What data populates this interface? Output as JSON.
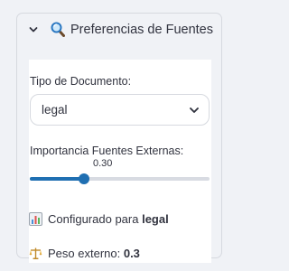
{
  "expander": {
    "title": "Preferencias de Fuentes",
    "toggle_icon": "chevron-down-icon",
    "title_icon": "magnifier-icon"
  },
  "document_type": {
    "label": "Tipo de Documento:",
    "selected": "legal",
    "dropdown_icon": "chevron-down-icon"
  },
  "external_importance": {
    "label": "Importancia Fuentes Externas:",
    "value_text": "0.30",
    "value": 0.3,
    "min": 0,
    "max": 1
  },
  "status": {
    "configured_prefix": "Configurado para",
    "configured_value": "legal",
    "configured_icon": "bar-chart-icon",
    "weight_prefix": "Peso externo:",
    "weight_value": "0.3",
    "weight_icon": "scales-icon"
  },
  "colors": {
    "accent": "#1f6fb2",
    "track": "#d8dbe2",
    "panel": "#f0f2f6"
  }
}
